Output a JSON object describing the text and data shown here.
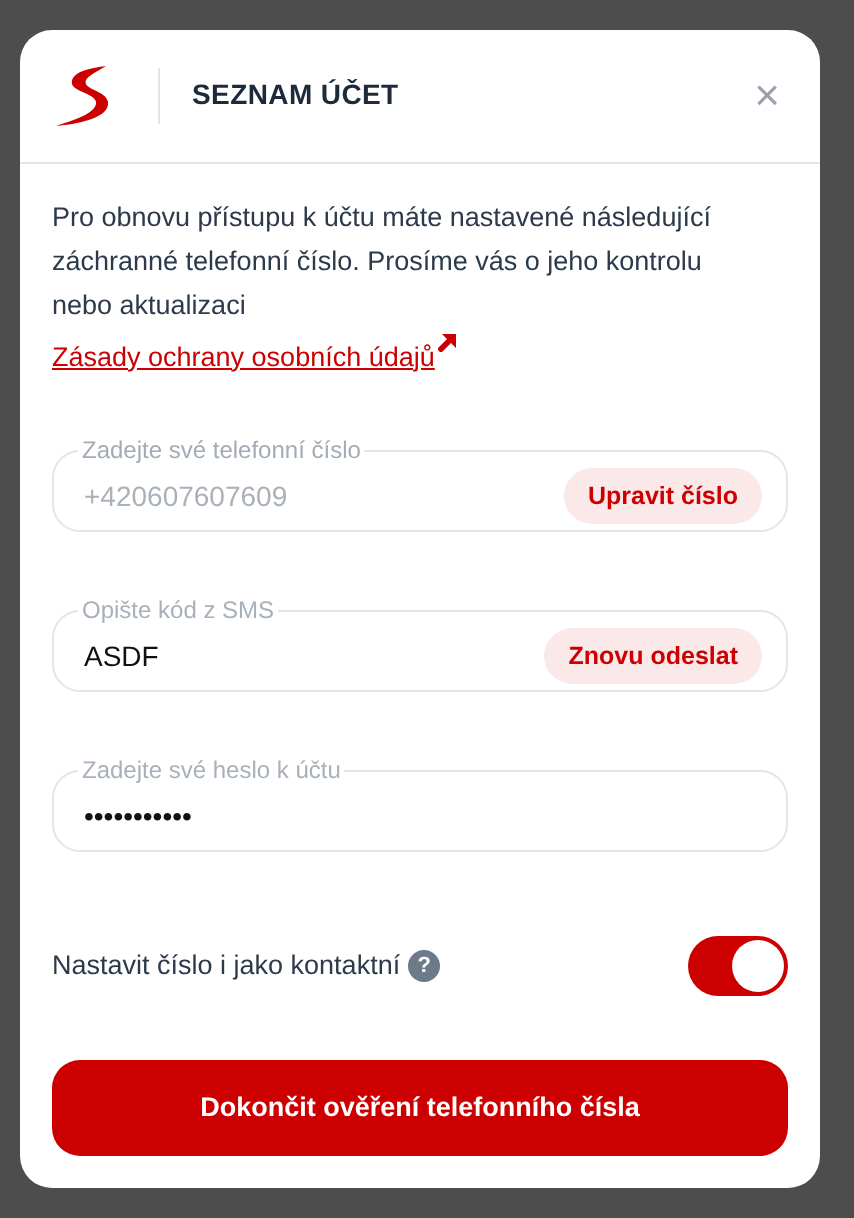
{
  "dialog": {
    "title": "SEZNAM ÚČET",
    "close": "×"
  },
  "intro": "Pro obnovu přístupu k účtu máte nastavené následující záchranné telefonní číslo. Prosíme vás o jeho kontrolu nebo aktualizaci",
  "privacy_link": "Zásady ochrany osobních údajů",
  "fields": [
    {
      "label": "Zadejte své telefonní číslo",
      "value": "+420607607609",
      "disabled": true,
      "button": "Upravit číslo"
    },
    {
      "label": "Opište kód z SMS",
      "value": "ASDF",
      "disabled": false,
      "button": "Znovu odeslat"
    },
    {
      "label": "Zadejte své heslo k účtu",
      "value": "•••••••••••",
      "disabled": false
    }
  ],
  "contact_toggle": {
    "label": "Nastavit číslo i jako kontaktní",
    "help": "?",
    "on": true
  },
  "submit": "Dokončit ověření telefonního čísla"
}
